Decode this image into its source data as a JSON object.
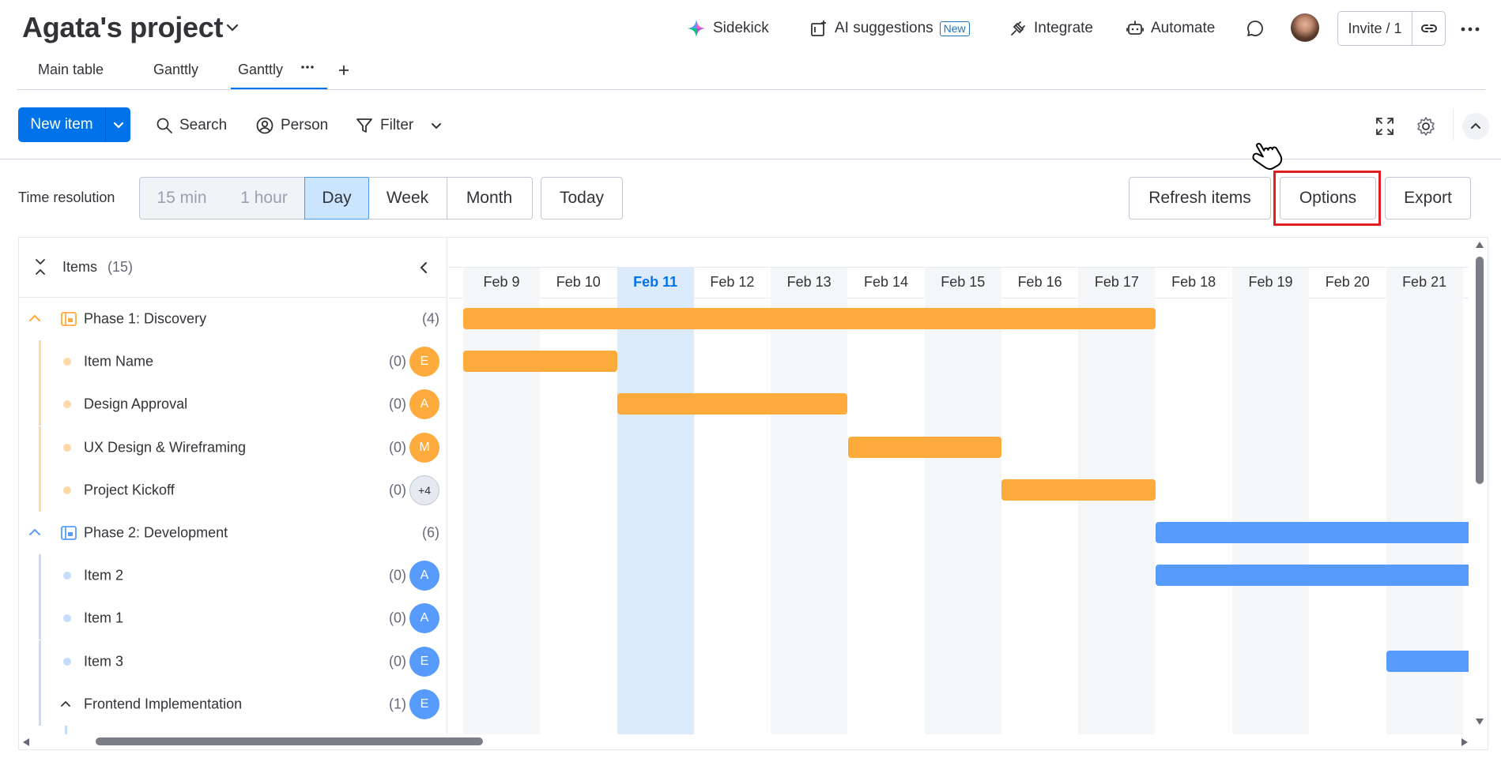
{
  "header": {
    "title": "Agata's project",
    "sidekick": "Sidekick",
    "ai_suggestions": "AI suggestions",
    "new_badge": "New",
    "integrate": "Integrate",
    "automate": "Automate",
    "invite": "Invite / 1"
  },
  "tabs": [
    {
      "label": "Main table",
      "active": false
    },
    {
      "label": "Ganttly",
      "active": false
    },
    {
      "label": "Ganttly",
      "active": true
    }
  ],
  "toolbar": {
    "new_item": "New item",
    "search": "Search",
    "person": "Person",
    "filter": "Filter"
  },
  "resolution": {
    "label": "Time resolution",
    "options": [
      {
        "label": "15 min",
        "state": "disabled"
      },
      {
        "label": "1 hour",
        "state": "disabled"
      },
      {
        "label": "Day",
        "state": "active"
      },
      {
        "label": "Week",
        "state": "normal"
      },
      {
        "label": "Month",
        "state": "normal"
      }
    ],
    "today": "Today",
    "refresh": "Refresh items",
    "options_btn": "Options",
    "export": "Export"
  },
  "items_panel": {
    "label": "Items",
    "count": "(15)",
    "rows": [
      {
        "type": "group",
        "label": "Phase 1: Discovery",
        "count": "(4)",
        "color": "#fdab3d"
      },
      {
        "type": "item",
        "label": "Item Name",
        "count": "(0)",
        "avatar": "E",
        "color": "#fdab3d",
        "dot": "#fdd9a8"
      },
      {
        "type": "item",
        "label": "Design Approval",
        "count": "(0)",
        "avatar": "A",
        "color": "#fdab3d",
        "dot": "#fdd9a8"
      },
      {
        "type": "item",
        "label": "UX Design & Wireframing",
        "count": "(0)",
        "avatar": "M",
        "color": "#fdab3d",
        "dot": "#fdd9a8"
      },
      {
        "type": "item",
        "label": "Project Kickoff",
        "count": "(0)",
        "avatar": "+4",
        "color": "#e6e9ef",
        "dot": "#fdd9a8"
      },
      {
        "type": "group",
        "label": "Phase 2: Development",
        "count": "(6)",
        "color": "#579bfc"
      },
      {
        "type": "item",
        "label": "Item 2",
        "count": "(0)",
        "avatar": "A",
        "color": "#579bfc",
        "dot": "#c6dcfb"
      },
      {
        "type": "item",
        "label": "Item 1",
        "count": "(0)",
        "avatar": "A",
        "color": "#579bfc",
        "dot": "#c6dcfb"
      },
      {
        "type": "item",
        "label": "Item 3",
        "count": "(0)",
        "avatar": "E",
        "color": "#579bfc",
        "dot": "#c6dcfb"
      },
      {
        "type": "subgroup",
        "label": "Frontend Implementation",
        "count": "(1)",
        "avatar": "E",
        "color": "#579bfc"
      }
    ]
  },
  "timeline": {
    "dates": [
      "Feb 9",
      "Feb 10",
      "Feb 11",
      "Feb 12",
      "Feb 13",
      "Feb 14",
      "Feb 15",
      "Feb 16",
      "Feb 17",
      "Feb 18",
      "Feb 19",
      "Feb 20",
      "Feb 21"
    ],
    "today": "Feb 11",
    "bars": [
      {
        "row": 0,
        "start": "Feb 9",
        "end": "Feb 17",
        "color": "#fdab3d"
      },
      {
        "row": 1,
        "start": "Feb 9",
        "end": "Feb 10",
        "color": "#fdab3d"
      },
      {
        "row": 2,
        "start": "Feb 11",
        "end": "Feb 13",
        "color": "#fdab3d"
      },
      {
        "row": 3,
        "start": "Feb 14",
        "end": "Feb 15",
        "color": "#fdab3d"
      },
      {
        "row": 4,
        "start": "Feb 16",
        "end": "Feb 17",
        "color": "#fdab3d"
      },
      {
        "row": 5,
        "start": "Feb 18",
        "end": "Feb 21",
        "color": "#579bfc"
      },
      {
        "row": 6,
        "start": "Feb 18",
        "end": "Feb 21",
        "color": "#579bfc"
      },
      {
        "row": 8,
        "start": "Feb 21",
        "end": "Feb 21",
        "color": "#579bfc"
      }
    ]
  },
  "colors": {
    "accent": "#0073ea",
    "highlight": "#e02020",
    "today_column": "#dcebfc",
    "weekend_column": "#f5f6f8"
  }
}
